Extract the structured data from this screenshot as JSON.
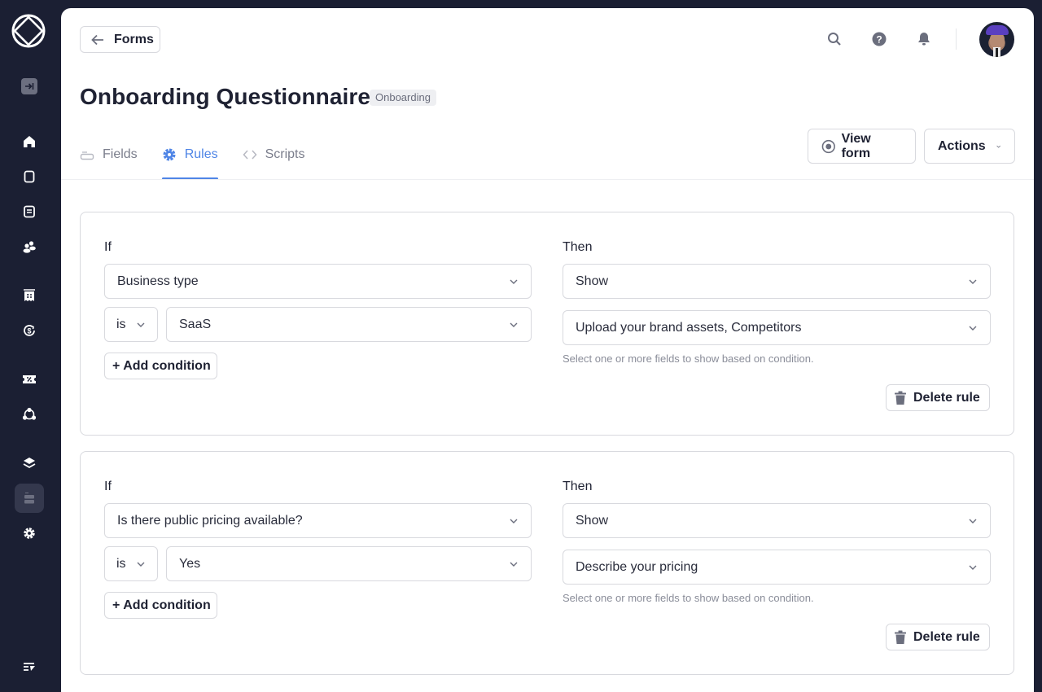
{
  "sidebar": {
    "logo": "app-logo",
    "collapse_icon": "collapse-sidebar-icon",
    "items": [
      {
        "icon": "home-icon",
        "label": "Home"
      },
      {
        "icon": "clipboard-icon",
        "label": "Orders"
      },
      {
        "icon": "message-icon",
        "label": "Messages"
      },
      {
        "icon": "users-icon",
        "label": "Clients"
      },
      {
        "icon": "invoice-icon",
        "label": "Invoices"
      },
      {
        "icon": "subscription-icon",
        "label": "Subscriptions"
      },
      {
        "icon": "coupon-icon",
        "label": "Coupons"
      },
      {
        "icon": "affiliates-icon",
        "label": "Affiliates"
      },
      {
        "icon": "layers-icon",
        "label": "Services"
      },
      {
        "icon": "forms-icon",
        "label": "Forms",
        "active": true
      },
      {
        "icon": "settings-icon",
        "label": "Settings"
      }
    ],
    "bottom_icon": "changelog-icon"
  },
  "header": {
    "back_label": "Forms",
    "top_icons": [
      "search-icon",
      "help-icon",
      "bell-icon"
    ],
    "avatar": "user-avatar"
  },
  "page": {
    "title": "Onboarding Questionnaire",
    "badge": "Onboarding"
  },
  "tabs": [
    {
      "label": "Fields",
      "icon": "field-icon",
      "active": false
    },
    {
      "label": "Rules",
      "icon": "gear-icon",
      "active": true
    },
    {
      "label": "Scripts",
      "icon": "code-icon",
      "active": false
    }
  ],
  "actions": {
    "view_form": "View form",
    "actions": "Actions"
  },
  "colors": {
    "accent": "#4f85e6",
    "sidebar_bg": "#1b1f33",
    "border": "#d8d9de"
  },
  "rules": [
    {
      "if_label": "If",
      "field": "Business type",
      "operator": "is",
      "value": "SaaS",
      "add_condition": "+ Add condition",
      "then_label": "Then",
      "action": "Show",
      "targets": "Upload your brand assets, Competitors",
      "helper": "Select one or more fields to show based on condition.",
      "delete": "Delete rule"
    },
    {
      "if_label": "If",
      "field": "Is there public pricing available?",
      "operator": "is",
      "value": "Yes",
      "add_condition": "+ Add condition",
      "then_label": "Then",
      "action": "Show",
      "targets": "Describe your pricing",
      "helper": "Select one or more fields to show based on condition.",
      "delete": "Delete rule"
    }
  ]
}
